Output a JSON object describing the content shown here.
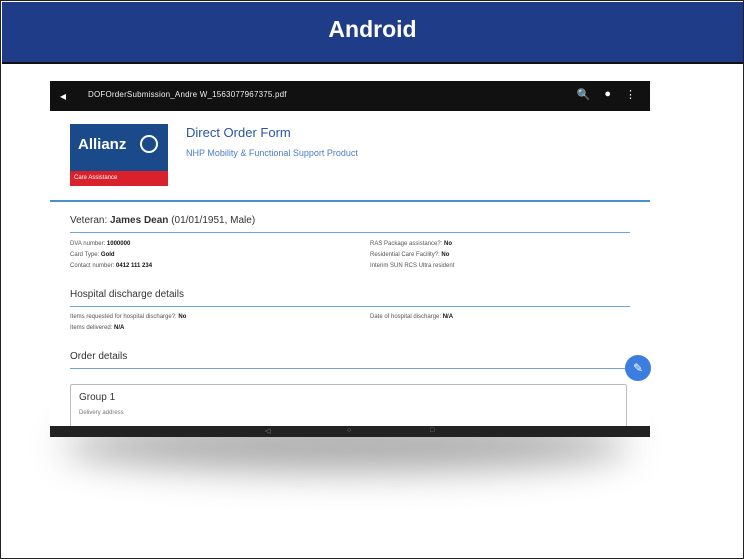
{
  "header": {
    "title": "Android"
  },
  "statusbar": {
    "back_icon": "◂",
    "filename": "DOFOrderSubmission_Andre W_1563077967375.pdf",
    "search_icon": "🔍",
    "share_icon": "●",
    "more_icon": "⋮"
  },
  "form": {
    "logo": {
      "name": "Allianz",
      "strip": "Care Assistance"
    },
    "title": "Direct Order Form",
    "subtitle": "NHP Mobility & Functional Support Product"
  },
  "veteran": {
    "heading_prefix": "Veteran:",
    "name": "James Dean",
    "details": "(01/01/1951, Male)",
    "left_fields": [
      {
        "label": "DVA number:",
        "value": "1000000"
      },
      {
        "label": "Card Type:",
        "value": "Gold"
      },
      {
        "label": "Contact number:",
        "value": "0412 111 234"
      }
    ],
    "right_fields": [
      {
        "label": "RAS Package assistance?:",
        "value": "No"
      },
      {
        "label": "Residential Care Facility?:",
        "value": "No"
      },
      {
        "label": "Interim SUN RCS Ultra resident",
        "value": ""
      }
    ]
  },
  "hospital": {
    "heading": "Hospital discharge details",
    "left_fields": [
      {
        "label": "Items requested for hospital discharge?:",
        "value": "No"
      },
      {
        "label": "Items delivered:",
        "value": "N/A"
      }
    ],
    "right_fields": [
      {
        "label": "Date of hospital discharge:",
        "value": "N/A"
      }
    ]
  },
  "order": {
    "heading": "Order details",
    "group_title": "Group 1",
    "group_sub": "Delivery address"
  },
  "fab_icon": "✎",
  "navbar_labels": [
    "◁",
    "○",
    "□"
  ]
}
